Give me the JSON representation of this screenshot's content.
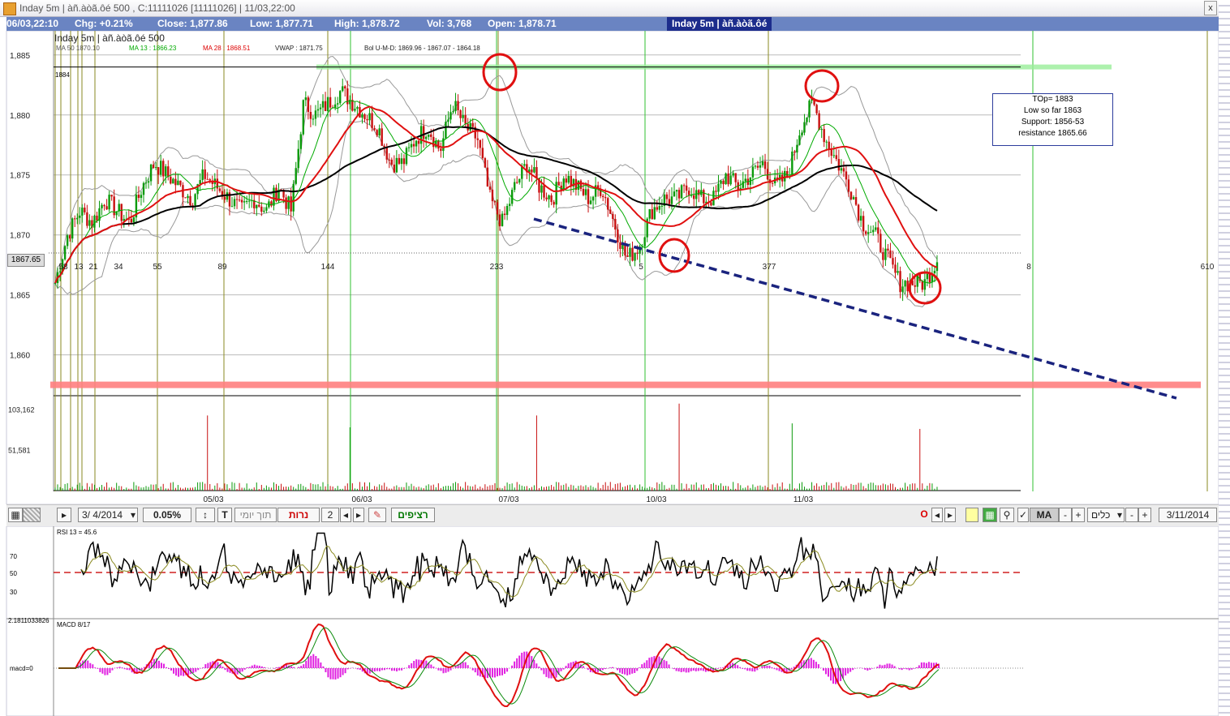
{
  "window": {
    "title": "Inday 5m | àñ.àòã.ôé 500 , C:11111026 [11111026] | 11/03,22:00",
    "close_label": "x"
  },
  "infobar": {
    "date": "06/03,22:10",
    "chg": "Chg: +0.21%",
    "close": "Close: 1,877.86",
    "low": "Low: 1,877.71",
    "high": "High: 1,878.72",
    "vol": "Vol: 3,768",
    "open": "Open: 1,878.71",
    "center_title": "Inday 5m | àñ.àòã.ôé"
  },
  "indicators": {
    "chart_title": "Inday 5m | àñ.àòã.ôé 500",
    "ma50": "MA 50   1870.10",
    "ma13": "MA 13 : 1866.23",
    "ma28": "MA 28 : 1868.51",
    "vwap": "VWAP  : 1871.75",
    "bol": "Bol U-M-D: 1869.96 - 1867.07 - 1864.18",
    "level_1884": "1884",
    "current_price": "1867.65"
  },
  "annotation": {
    "lines": [
      "TOp= 1883",
      "Low so far 1863",
      "Support: 1856-53",
      "resistance 1865.66"
    ]
  },
  "toolbar": {
    "date_value": "3/ 4/2014",
    "percent_value": "0.05%",
    "t_label": "T",
    "intraday_label": "תוך יומי",
    "candles_label": "נרות",
    "period_value": "2",
    "continuous_label": "רציפים",
    "o_label": "O",
    "ma_label": "MA",
    "tools_label": "כלים",
    "end_date": "3/11/2014",
    "minus": "-",
    "plus": "+"
  },
  "chart_data": [
    {
      "type": "candlestick",
      "title": "Inday 5m | àñ.àòã.ôé 500",
      "ylim": [
        1857,
        1886
      ],
      "y_ticks": [
        "1,885",
        "1,880",
        "1,875",
        "1,870",
        "1,865",
        "1,860"
      ],
      "y_tick_values": [
        1885,
        1880,
        1875,
        1870,
        1865,
        1860
      ],
      "x_date_labels": [
        "05/03",
        "06/03",
        "07/03",
        "10/03",
        "11/03"
      ],
      "fib_labels": [
        "58",
        "13",
        "21",
        "34",
        "55",
        "89",
        "144",
        "233",
        "5",
        "377",
        "8",
        "610"
      ],
      "horizontal_levels": [
        {
          "value": 1884,
          "color": "#99ee99"
        },
        {
          "value": 1857.5,
          "color": "#ff8080"
        }
      ],
      "trendline": {
        "from": [
          1870.5,
          "07/03"
        ],
        "to": [
          1856.5,
          "12/03"
        ],
        "color": "#1a237e",
        "style": "dashed"
      },
      "close_path": [
        1866,
        1870,
        1872,
        1871,
        1873,
        1872,
        1871,
        1874,
        1876,
        1875,
        1874,
        1873,
        1875,
        1874,
        1873,
        1872,
        1873,
        1872,
        1874,
        1872,
        1881,
        1880,
        1881,
        1882,
        1881,
        1880,
        1879,
        1876,
        1876,
        1878,
        1879,
        1877,
        1881,
        1879,
        1878,
        1873,
        1871,
        1874,
        1876,
        1874,
        1873,
        1875,
        1874,
        1873,
        1874,
        1871,
        1868,
        1869,
        1872,
        1873,
        1873,
        1874,
        1873,
        1873,
        1875,
        1874,
        1875,
        1876,
        1874,
        1875,
        1879,
        1881,
        1878,
        1876,
        1874,
        1871,
        1870,
        1868,
        1866,
        1866,
        1866,
        1868
      ]
    },
    {
      "type": "bar",
      "title": "Volume",
      "y_ticks": [
        "103,162",
        "51,581"
      ],
      "y_tick_values": [
        103162,
        51581
      ],
      "ylim": [
        0,
        120000
      ]
    },
    {
      "type": "line",
      "title": "RSI 13 = 45.6",
      "y_ticks": [
        "70",
        "50",
        "30"
      ],
      "y_tick_values": [
        70,
        50,
        30
      ],
      "ylim": [
        15,
        85
      ],
      "reference_line": 50
    },
    {
      "type": "bar",
      "title": "MACD 8/17",
      "top_label": "2.1811033826",
      "zero_label": "macd=0"
    }
  ]
}
